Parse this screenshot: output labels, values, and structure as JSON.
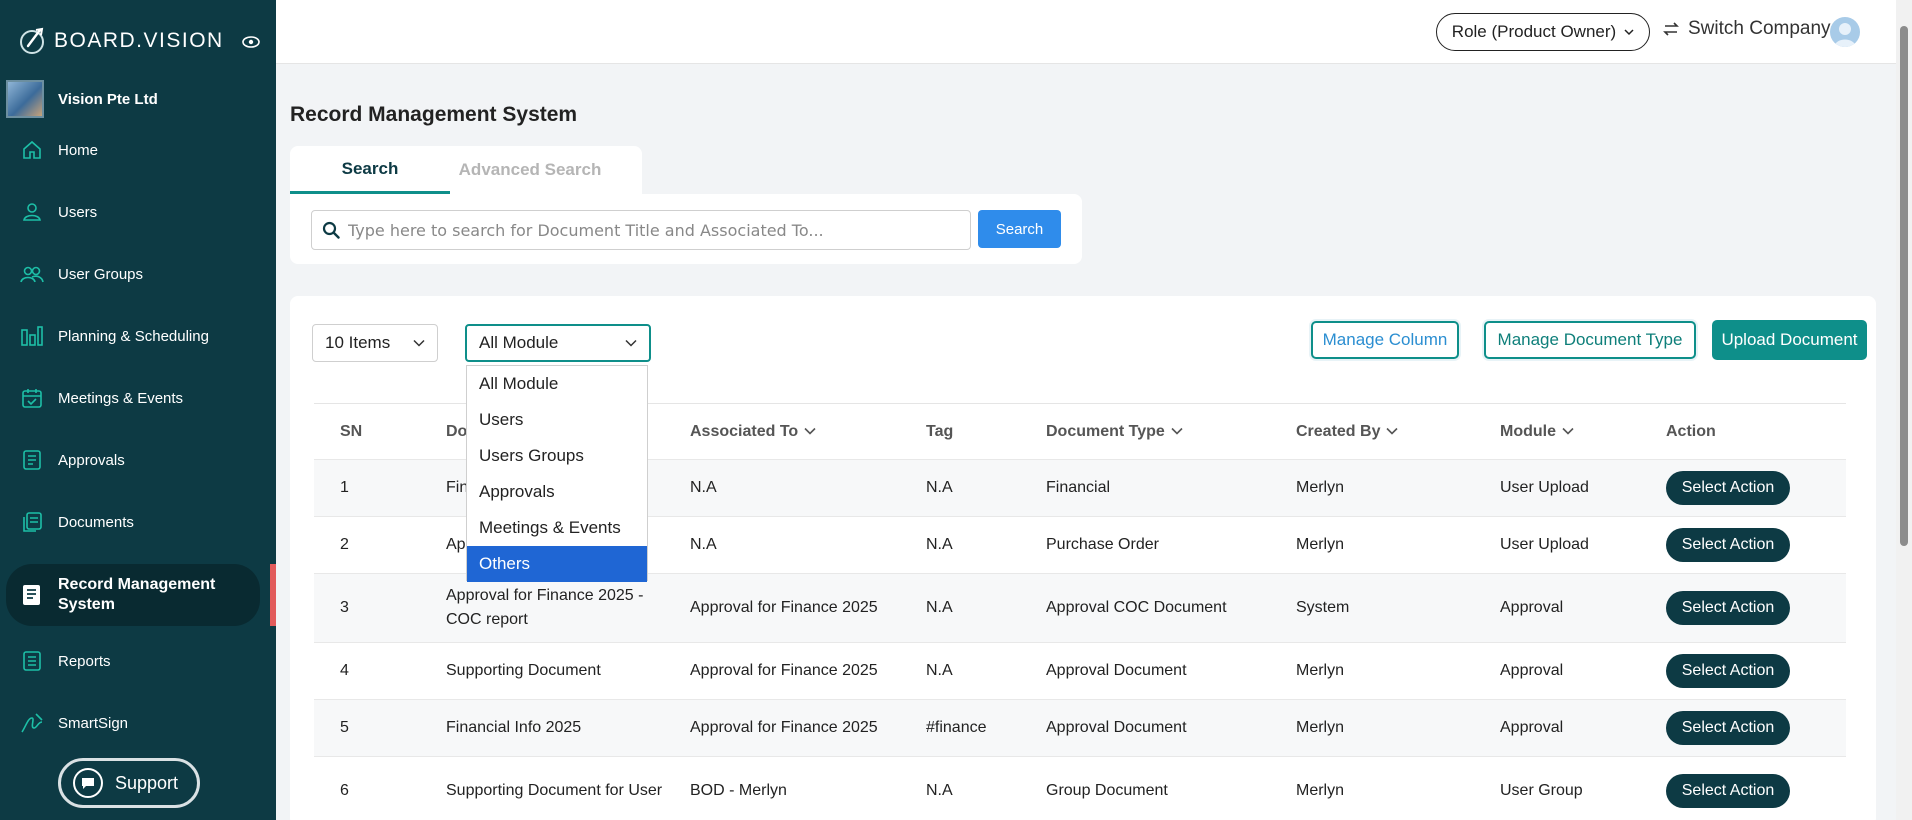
{
  "brand": {
    "name": "BOARD.VISION"
  },
  "company": {
    "name": "Vision Pte Ltd"
  },
  "sidebar": {
    "items": [
      {
        "label": "Home",
        "icon": "home-icon"
      },
      {
        "label": "Users",
        "icon": "user-icon"
      },
      {
        "label": "User Groups",
        "icon": "users-icon"
      },
      {
        "label": "Planning & Scheduling",
        "icon": "bar-chart-icon"
      },
      {
        "label": "Meetings & Events",
        "icon": "calendar-icon"
      },
      {
        "label": "Approvals",
        "icon": "document-icon"
      },
      {
        "label": "Documents",
        "icon": "documents-icon"
      },
      {
        "label": "Record Management System",
        "icon": "record-icon",
        "active": true
      },
      {
        "label": "Reports",
        "icon": "report-icon"
      },
      {
        "label": "SmartSign",
        "icon": "signature-icon"
      }
    ],
    "support_label": "Support"
  },
  "topbar": {
    "role_label": "Role (Product Owner)",
    "switch_company_label": "Switch Company"
  },
  "page": {
    "title": "Record Management System",
    "tabs": {
      "search": "Search",
      "advanced": "Advanced Search"
    },
    "search": {
      "placeholder": "Type here to search for Document Title and Associated To...",
      "button_label": "Search"
    }
  },
  "filters": {
    "items_per_page": "10 Items",
    "module_selected": "All Module",
    "module_options": [
      "All Module",
      "Users",
      "Users Groups",
      "Approvals",
      "Meetings & Events",
      "Others"
    ],
    "highlighted_option": "Others"
  },
  "actions": {
    "manage_column": "Manage Column",
    "manage_document_type": "Manage Document Type",
    "upload_document": "Upload Document"
  },
  "table": {
    "headers": [
      "SN",
      "Do",
      "Associated To",
      "Tag",
      "Document Type",
      "Created By",
      "Module",
      "Action"
    ],
    "rows": [
      {
        "sn": "1",
        "title": "Fin",
        "associated": "N.A",
        "tag": "N.A",
        "doc_type": "Financial",
        "created_by": "Merlyn",
        "module": "User Upload",
        "action": "Select Action"
      },
      {
        "sn": "2",
        "title": "Ap",
        "associated": "N.A",
        "tag": "N.A",
        "doc_type": "Purchase Order",
        "created_by": "Merlyn",
        "module": "User Upload",
        "action": "Select Action"
      },
      {
        "sn": "3",
        "title": "Approval for Finance 2025 - COC report",
        "associated": "Approval for Finance 2025",
        "tag": "N.A",
        "doc_type": "Approval COC Document",
        "created_by": "System",
        "module": "Approval",
        "action": "Select Action"
      },
      {
        "sn": "4",
        "title": "Supporting Document",
        "associated": "Approval for Finance 2025",
        "tag": "N.A",
        "doc_type": "Approval Document",
        "created_by": "Merlyn",
        "module": "Approval",
        "action": "Select Action"
      },
      {
        "sn": "5",
        "title": "Financial Info 2025",
        "associated": "Approval for Finance 2025",
        "tag": "#finance",
        "doc_type": "Approval Document",
        "created_by": "Merlyn",
        "module": "Approval",
        "action": "Select Action"
      },
      {
        "sn": "6",
        "title": "Supporting Document for User",
        "associated": "BOD - Merlyn",
        "tag": "N.A",
        "doc_type": "Group Document",
        "created_by": "Merlyn",
        "module": "User Group",
        "action": "Select Action"
      }
    ]
  },
  "colors": {
    "sidebar": "#0d3a44",
    "accent": "#0e8f8a",
    "primary_button": "#2f8ceb",
    "active_marker": "#e25b5b"
  }
}
